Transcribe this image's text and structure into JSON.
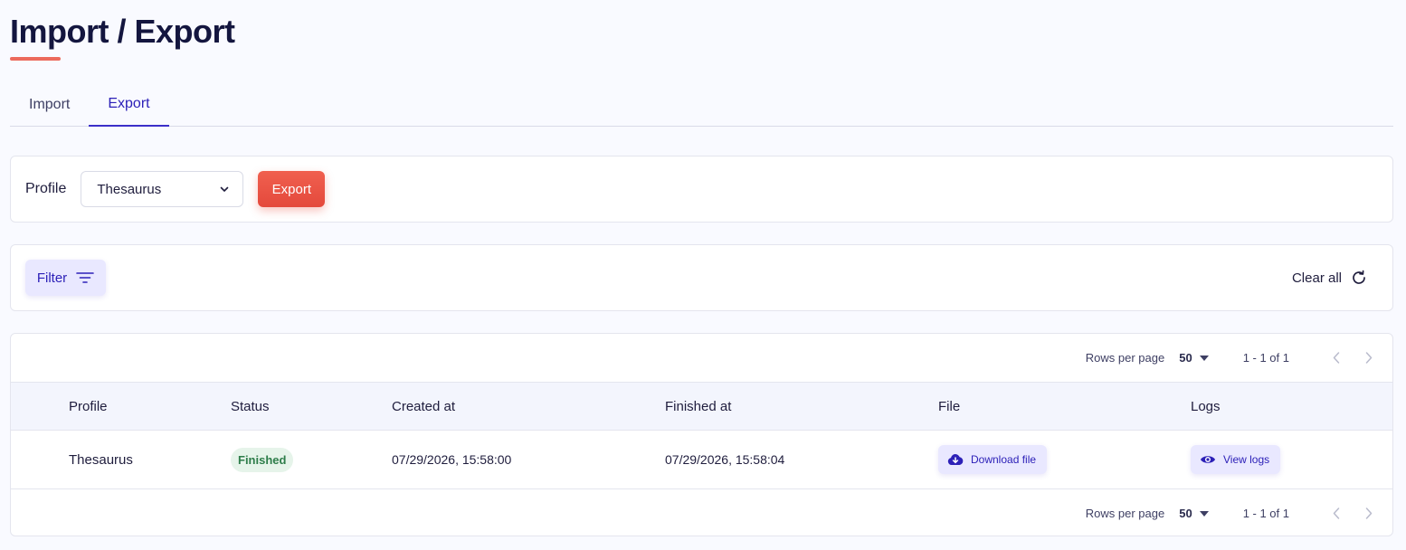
{
  "page": {
    "title": "Import / Export"
  },
  "tabs": [
    {
      "label": "Import",
      "active": false
    },
    {
      "label": "Export",
      "active": true
    }
  ],
  "export_form": {
    "profile_label": "Profile",
    "profile_value": "Thesaurus",
    "export_label": "Export"
  },
  "filter_bar": {
    "filter_label": "Filter",
    "clear_all_label": "Clear all"
  },
  "pagination": {
    "rows_per_page_label": "Rows per page",
    "rows_per_page_value": "50",
    "range": "1 - 1 of 1"
  },
  "table": {
    "columns": [
      "Profile",
      "Status",
      "Created at",
      "Finished at",
      "File",
      "Logs"
    ],
    "rows": [
      {
        "profile": "Thesaurus",
        "status": "Finished",
        "created_at": "07/29/2026, 15:58:00",
        "finished_at": "07/29/2026, 15:58:04",
        "file_action": "Download file",
        "logs_action": "View logs"
      }
    ]
  },
  "colors": {
    "accent": "#2d21b8",
    "primary_button": "#e4493c",
    "title_underline": "#ec6a5c",
    "status_finished": "#2e7d4a"
  },
  "icons": {
    "select_chevron": "chevron-down-icon",
    "filter": "filter-lines-icon",
    "clear_all": "refresh-icon",
    "download": "cloud-download-icon",
    "view_logs": "eye-icon",
    "prev": "chevron-left-icon",
    "next": "chevron-right-icon"
  }
}
